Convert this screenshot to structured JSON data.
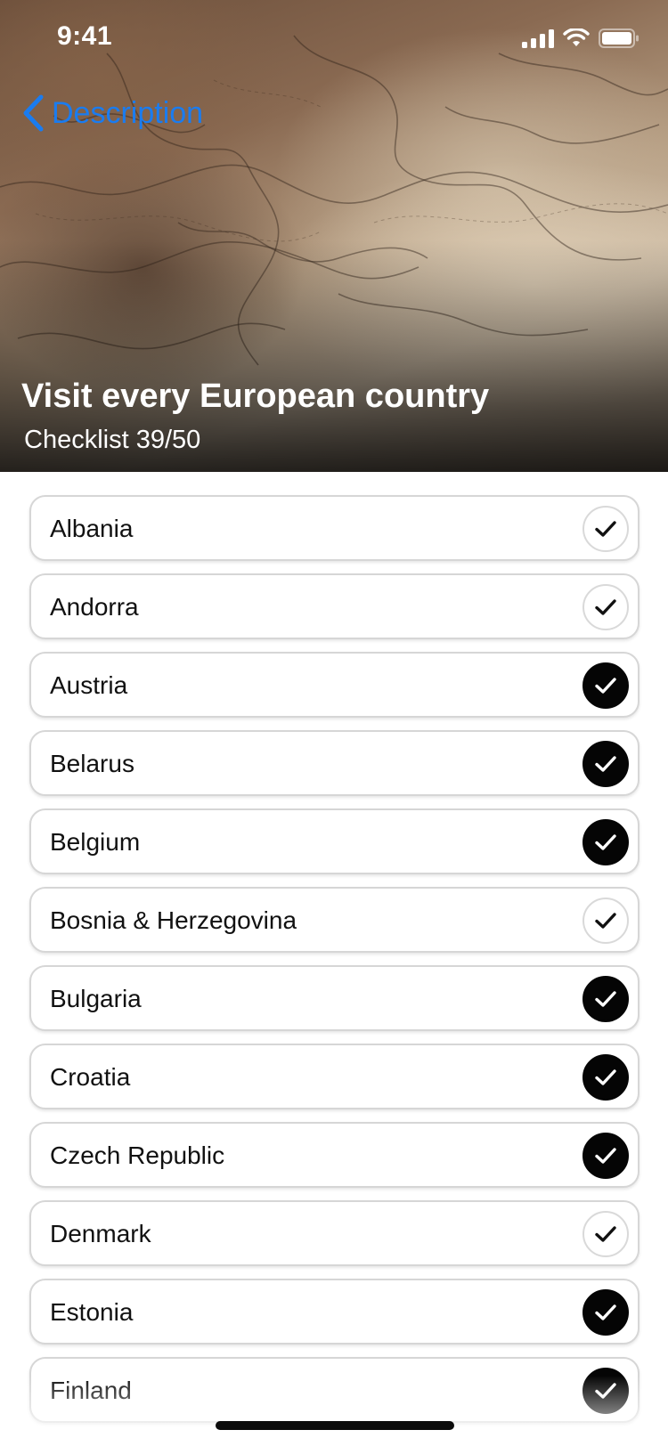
{
  "status_bar": {
    "time": "9:41",
    "icons": [
      "cellular-signal-icon",
      "wifi-icon",
      "battery-icon"
    ]
  },
  "nav": {
    "back_label": "Description",
    "back_icon": "chevron-left-icon"
  },
  "header": {
    "title": "Visit every European country",
    "subtitle": "Checklist 39/50",
    "background": "vintage-map-photo"
  },
  "colors": {
    "accent": "#1a7cf0",
    "checked": "#050505",
    "unchecked_border": "#d9d9d9",
    "row_border": "#d6d6d6"
  },
  "items": [
    {
      "label": "Albania",
      "checked": false
    },
    {
      "label": "Andorra",
      "checked": false
    },
    {
      "label": "Austria",
      "checked": true
    },
    {
      "label": "Belarus",
      "checked": true
    },
    {
      "label": "Belgium",
      "checked": true
    },
    {
      "label": "Bosnia & Herzegovina",
      "checked": false
    },
    {
      "label": "Bulgaria",
      "checked": true
    },
    {
      "label": "Croatia",
      "checked": true
    },
    {
      "label": "Czech Republic",
      "checked": true
    },
    {
      "label": "Denmark",
      "checked": false
    },
    {
      "label": "Estonia",
      "checked": true
    },
    {
      "label": "Finland",
      "checked": true
    }
  ]
}
